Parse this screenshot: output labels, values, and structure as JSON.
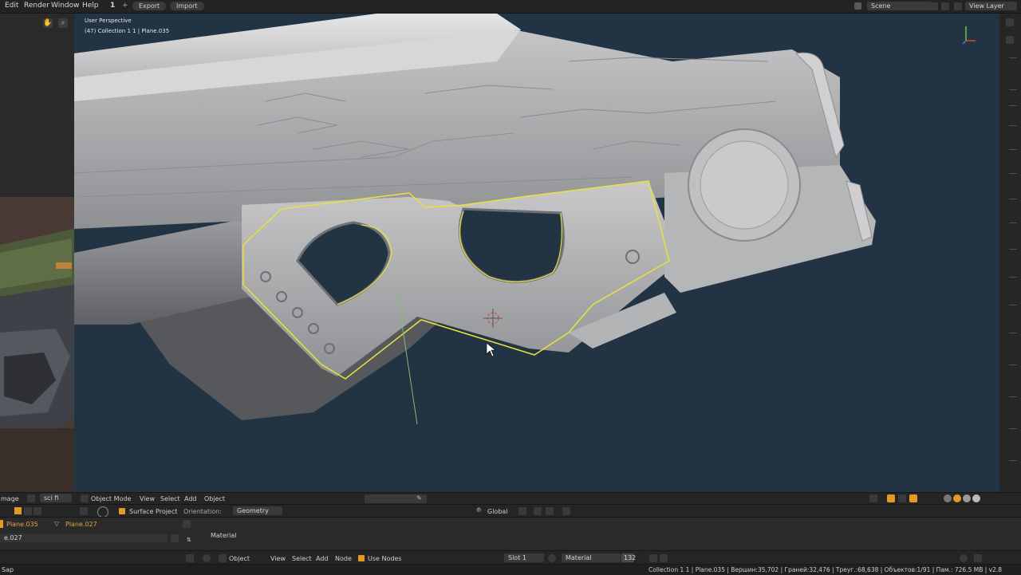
{
  "menu": {
    "items": [
      "Edit",
      "Render",
      "Window",
      "Help"
    ],
    "tab_number": "1",
    "export_label": "Export",
    "import_label": "Import",
    "scene_label": "Scene",
    "view_layer_label": "View Layer"
  },
  "viewport": {
    "perspective": "User Perspective",
    "collection_info": "(47) Collection 1 1 | Plane.035"
  },
  "header": {
    "left_labels": [
      "mage",
      "sci fi gun."
    ],
    "mode": "Object Mode",
    "menus": [
      "View",
      "Select",
      "Add",
      "Object"
    ],
    "surface_project": "Surface Project",
    "orientation_label": "Orientation:",
    "orientation_value": "Geometry",
    "transform_label": "Global"
  },
  "outliner": {
    "items": [
      "Plane.035",
      "Plane.027"
    ],
    "row": "e.027"
  },
  "material_header": "Material",
  "node_bar": {
    "object_label": "Object",
    "menus": [
      "View",
      "Select",
      "Add",
      "Node"
    ],
    "use_nodes": "Use Nodes",
    "slot": "Slot 1",
    "material": "Material",
    "users": "132"
  },
  "status": {
    "left": "Sap",
    "text": "Collection 1 1 | Plane.035 | Вершин:35,702 | Граней:32,476 | Треуг.:68,638 | Объектов:1/91 | Пам.: 726.5 MB | v2.8"
  },
  "colors": {
    "viewport_bg": "#223344",
    "selection_outline": "#e8e23a",
    "accent_orange": "#e39a24"
  }
}
